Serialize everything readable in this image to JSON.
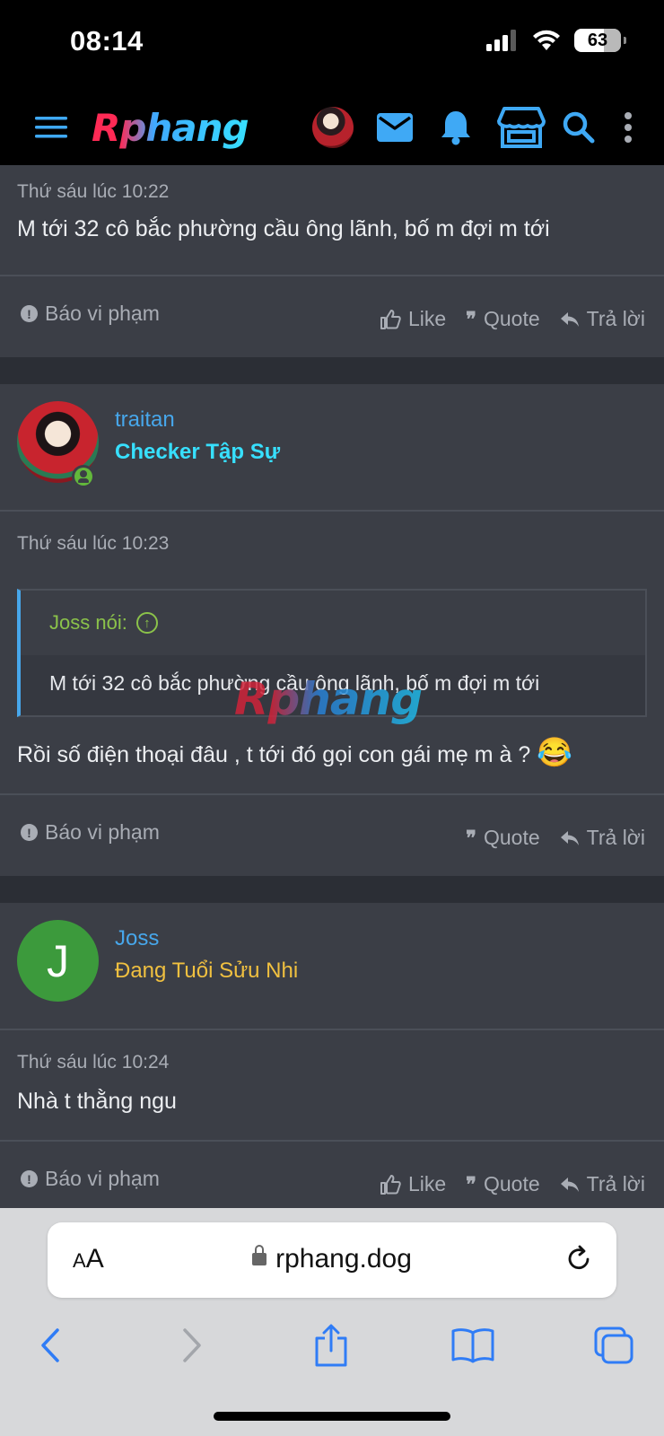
{
  "status_bar": {
    "time": "08:14",
    "battery": "63"
  },
  "header": {
    "logo": "Rphang"
  },
  "posts": [
    {
      "date": "Thứ sáu lúc 10:22",
      "text": "M tới 32 cô bắc phường cầu ông lãnh, bố m đợi m tới",
      "report": "Báo vi phạm",
      "like": "Like",
      "quote": "Quote",
      "reply": "Trả lời"
    },
    {
      "username": "traitan",
      "user_title": "Checker Tập Sự",
      "date": "Thứ sáu lúc 10:23",
      "quote_author": "Joss nói:",
      "quote_text": "M tới 32 cô bắc phường cầu ông lãnh, bố m đợi m tới",
      "watermark": "Rphang",
      "text": "Rồi số điện thoại đâu , t tới đó gọi con gái mẹ m à ?",
      "emoji": "😂",
      "report": "Báo vi phạm",
      "quote": "Quote",
      "reply": "Trả lời"
    },
    {
      "username": "Joss",
      "avatar_letter": "J",
      "user_title": "Đang Tuổi Sửu Nhi",
      "date": "Thứ sáu lúc 10:24",
      "text": "Nhà t thằng ngu",
      "report": "Báo vi phạm",
      "like": "Like",
      "quote": "Quote",
      "reply": "Trả lời"
    }
  ],
  "browser": {
    "aa_small": "A",
    "aa_large": "A",
    "url": "rphang.dog"
  },
  "icons": {
    "menu": "menu-icon",
    "mail": "mail-icon",
    "bell": "bell-icon",
    "store": "store-icon",
    "search": "search-icon",
    "more": "more-vertical-icon"
  },
  "colors": {
    "accent_blue": "#47a7eb",
    "checker_cyan": "#37e0ff",
    "joss_gold": "#f0c040",
    "quote_green": "#8bc24a"
  }
}
